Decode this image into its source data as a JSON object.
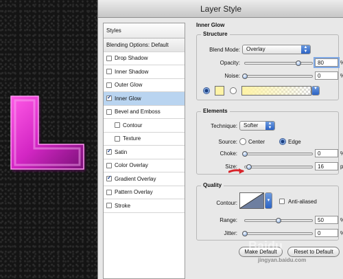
{
  "dialog": {
    "title": "Layer Style"
  },
  "styles_panel": {
    "header": "Styles",
    "blending_options": "Blending Options: Default",
    "items": [
      {
        "label": "Drop Shadow",
        "checked": false
      },
      {
        "label": "Inner Shadow",
        "checked": false
      },
      {
        "label": "Outer Glow",
        "checked": false
      },
      {
        "label": "Inner Glow",
        "checked": true,
        "selected": true
      },
      {
        "label": "Bevel and Emboss",
        "checked": false
      },
      {
        "label": "Contour",
        "checked": false,
        "sub": true
      },
      {
        "label": "Texture",
        "checked": false,
        "sub": true
      },
      {
        "label": "Satin",
        "checked": true
      },
      {
        "label": "Color Overlay",
        "checked": false
      },
      {
        "label": "Gradient Overlay",
        "checked": true
      },
      {
        "label": "Pattern Overlay",
        "checked": false
      },
      {
        "label": "Stroke",
        "checked": false
      }
    ]
  },
  "inner_glow": {
    "title": "Inner Glow",
    "structure": {
      "title": "Structure",
      "blend_mode_label": "Blend Mode:",
      "blend_mode_value": "Overlay",
      "opacity_label": "Opacity:",
      "opacity_value": "80",
      "opacity_level": 0.8,
      "noise_label": "Noise:",
      "noise_value": "0",
      "noise_level": 0,
      "percent": "%",
      "glow_color": "#fff3a6"
    },
    "elements": {
      "title": "Elements",
      "technique_label": "Technique:",
      "technique_value": "Softer",
      "source_label": "Source:",
      "source_center": "Center",
      "source_edge": "Edge",
      "choke_label": "Choke:",
      "choke_value": "0",
      "choke_level": 0,
      "size_label": "Size:",
      "size_value": "16",
      "size_level": 0.064,
      "percent": "%",
      "px": "px"
    },
    "quality": {
      "title": "Quality",
      "contour_label": "Contour:",
      "anti_aliased_label": "Anti-aliased",
      "range_label": "Range:",
      "range_value": "50",
      "range_level": 0.5,
      "jitter_label": "Jitter:",
      "jitter_value": "0",
      "jitter_level": 0,
      "percent": "%"
    },
    "buttons": {
      "make_default": "Make Default",
      "reset_default": "Reset to Default"
    }
  },
  "watermark": {
    "brand": "Baidu",
    "site": "jingyan.baidu.com"
  },
  "colors": {
    "accent": "#3a6fd0",
    "letter": "#e23ad0",
    "arrow": "#d8242a"
  }
}
